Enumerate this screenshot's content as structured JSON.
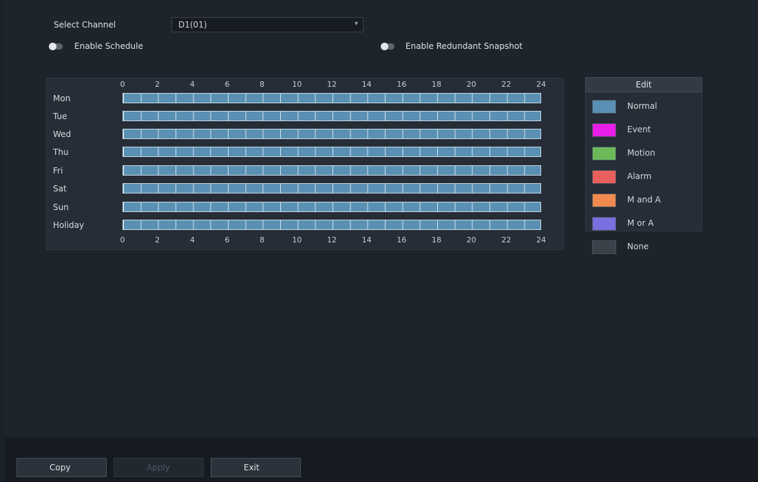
{
  "channel": {
    "label": "Select Channel",
    "value": "D1(01)"
  },
  "toggles": {
    "enable_schedule": {
      "label": "Enable Schedule",
      "on": false
    },
    "enable_redundant_snapshot": {
      "label": "Enable Redundant Snapshot",
      "on": false
    }
  },
  "schedule": {
    "hour_ticks": [
      "0",
      "2",
      "4",
      "6",
      "8",
      "10",
      "12",
      "14",
      "16",
      "18",
      "20",
      "22",
      "24"
    ],
    "days": [
      {
        "label": "Mon",
        "mode": "Normal"
      },
      {
        "label": "Tue",
        "mode": "Normal"
      },
      {
        "label": "Wed",
        "mode": "Normal"
      },
      {
        "label": "Thu",
        "mode": "Normal"
      },
      {
        "label": "Fri",
        "mode": "Normal"
      },
      {
        "label": "Sat",
        "mode": "Normal"
      },
      {
        "label": "Sun",
        "mode": "Normal"
      },
      {
        "label": "Holiday",
        "mode": "Normal"
      }
    ]
  },
  "legend": {
    "edit_label": "Edit",
    "items": [
      {
        "label": "Normal",
        "color": "#5a90b3"
      },
      {
        "label": "Event",
        "color": "#e81ee8"
      },
      {
        "label": "Motion",
        "color": "#6cb95a"
      },
      {
        "label": "Alarm",
        "color": "#e8605d"
      },
      {
        "label": "M and A",
        "color": "#f08a4f"
      },
      {
        "label": "M or A",
        "color": "#7a6fe0"
      },
      {
        "label": "None",
        "color": "#3a4149"
      }
    ]
  },
  "footer": {
    "copy_label": "Copy",
    "apply_label": "Apply",
    "exit_label": "Exit"
  }
}
